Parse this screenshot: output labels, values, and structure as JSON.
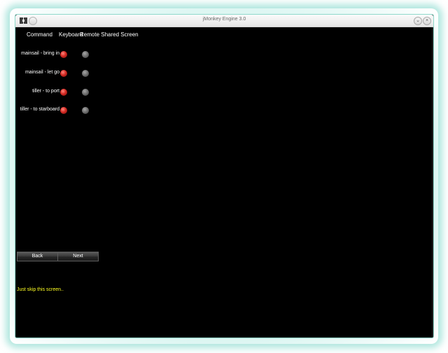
{
  "window": {
    "title": "jMonkey Engine 3.0"
  },
  "table": {
    "headers": [
      "Command",
      "Keyboard",
      "Remote Shared Screen"
    ],
    "rows": [
      {
        "command": "mainsail - bring in",
        "keyboard": "active",
        "remote": "inactive"
      },
      {
        "command": "mainsail - let go",
        "keyboard": "active",
        "remote": "inactive"
      },
      {
        "command": "tiller - to port",
        "keyboard": "active",
        "remote": "inactive"
      },
      {
        "command": "tiller - to starboard",
        "keyboard": "active",
        "remote": "inactive"
      }
    ]
  },
  "buttons": {
    "back": "Back",
    "next": "Next"
  },
  "hint": "Just skip this screen..",
  "colors": {
    "background": "#000000",
    "hint": "#ffff22",
    "active_dot": "#d42a23",
    "inactive_dot": "#6b6b6b",
    "window_glow": "#6ed2c3"
  },
  "icons": {
    "app": "jmonkey-app-icon",
    "menu": "window-menu-icon",
    "minimize": "minimize-icon",
    "close": "close-icon"
  }
}
